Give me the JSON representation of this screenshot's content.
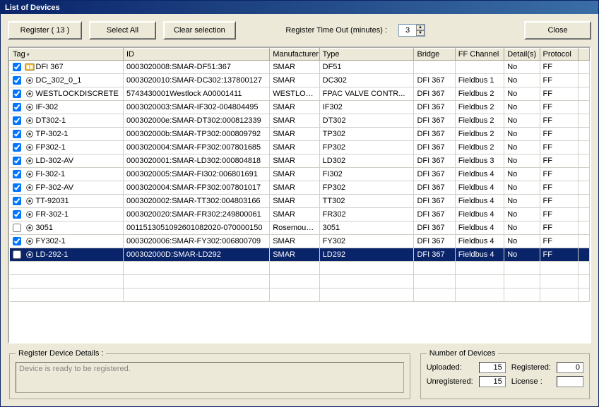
{
  "window": {
    "title": "List of Devices"
  },
  "toolbar": {
    "register_label": "Register ( 13 )",
    "select_all_label": "Select All",
    "clear_selection_label": "Clear selection",
    "timeout_label": "Register Time Out (minutes) :",
    "timeout_value": "3",
    "close_label": "Close"
  },
  "columns": {
    "tag": "Tag",
    "id": "ID",
    "manufacturer": "Manufacturer",
    "type": "Type",
    "bridge": "Bridge",
    "ff_channel": "FF Channel",
    "details": "Detail(s)",
    "protocol": "Protocol"
  },
  "rows": [
    {
      "checked": true,
      "selected": false,
      "icon": "bridge",
      "tag": "DFI 367",
      "id": "0003020008:SMAR-DF51:367",
      "manufacturer": "SMAR",
      "type": "DF51",
      "bridge": "",
      "ff_channel": "",
      "details": "No",
      "protocol": "FF"
    },
    {
      "checked": true,
      "selected": false,
      "icon": "device",
      "tag": "DC_302_0_1",
      "id": "0003020010:SMAR-DC302:137800127",
      "manufacturer": "SMAR",
      "type": "DC302",
      "bridge": "DFI 367",
      "ff_channel": "Fieldbus 1",
      "details": "No",
      "protocol": "FF"
    },
    {
      "checked": true,
      "selected": false,
      "icon": "device",
      "tag": "WESTLOCKDISCRETE",
      "id": "5743430001Westlock    A00001411",
      "manufacturer": "WESTLOCK",
      "type": "FPAC VALVE CONTR...",
      "bridge": "DFI 367",
      "ff_channel": "Fieldbus 2",
      "details": "No",
      "protocol": "FF"
    },
    {
      "checked": true,
      "selected": false,
      "icon": "device",
      "tag": "IF-302",
      "id": "0003020003:SMAR-IF302-004804495",
      "manufacturer": "SMAR",
      "type": "IF302",
      "bridge": "DFI 367",
      "ff_channel": "Fieldbus 2",
      "details": "No",
      "protocol": "FF"
    },
    {
      "checked": true,
      "selected": false,
      "icon": "device",
      "tag": "DT302-1",
      "id": "000302000e:SMAR-DT302:000812339",
      "manufacturer": "SMAR",
      "type": "DT302",
      "bridge": "DFI 367",
      "ff_channel": "Fieldbus 2",
      "details": "No",
      "protocol": "FF"
    },
    {
      "checked": true,
      "selected": false,
      "icon": "device",
      "tag": "TP-302-1",
      "id": "000302000b:SMAR-TP302:000809792",
      "manufacturer": "SMAR",
      "type": "TP302",
      "bridge": "DFI 367",
      "ff_channel": "Fieldbus 2",
      "details": "No",
      "protocol": "FF"
    },
    {
      "checked": true,
      "selected": false,
      "icon": "device",
      "tag": "FP302-1",
      "id": "0003020004:SMAR-FP302:007801685",
      "manufacturer": "SMAR",
      "type": "FP302",
      "bridge": "DFI 367",
      "ff_channel": "Fieldbus 2",
      "details": "No",
      "protocol": "FF"
    },
    {
      "checked": true,
      "selected": false,
      "icon": "device",
      "tag": "LD-302-AV",
      "id": "0003020001:SMAR-LD302:000804818",
      "manufacturer": "SMAR",
      "type": "LD302",
      "bridge": "DFI 367",
      "ff_channel": "Fieldbus 3",
      "details": "No",
      "protocol": "FF"
    },
    {
      "checked": true,
      "selected": false,
      "icon": "device",
      "tag": "FI-302-1",
      "id": "0003020005:SMAR-FI302:006801691",
      "manufacturer": "SMAR",
      "type": "FI302",
      "bridge": "DFI 367",
      "ff_channel": "Fieldbus 4",
      "details": "No",
      "protocol": "FF"
    },
    {
      "checked": true,
      "selected": false,
      "icon": "device",
      "tag": "FP-302-AV",
      "id": "0003020004:SMAR-FP302:007801017",
      "manufacturer": "SMAR",
      "type": "FP302",
      "bridge": "DFI 367",
      "ff_channel": "Fieldbus 4",
      "details": "No",
      "protocol": "FF"
    },
    {
      "checked": true,
      "selected": false,
      "icon": "device",
      "tag": "TT-92031",
      "id": "0003020002:SMAR-TT302:004803166",
      "manufacturer": "SMAR",
      "type": "TT302",
      "bridge": "DFI 367",
      "ff_channel": "Fieldbus 4",
      "details": "No",
      "protocol": "FF"
    },
    {
      "checked": true,
      "selected": false,
      "icon": "device",
      "tag": "FR-302-1",
      "id": "0003020020:SMAR-FR302:249800061",
      "manufacturer": "SMAR",
      "type": "FR302",
      "bridge": "DFI 367",
      "ff_channel": "Fieldbus 4",
      "details": "No",
      "protocol": "FF"
    },
    {
      "checked": false,
      "selected": false,
      "icon": "device",
      "tag": "3051",
      "id": "0011513051092601082020-070000150",
      "manufacturer": "Rosemount...",
      "type": "3051",
      "bridge": "DFI 367",
      "ff_channel": "Fieldbus 4",
      "details": "No",
      "protocol": "FF"
    },
    {
      "checked": true,
      "selected": false,
      "icon": "device",
      "tag": "FY302-1",
      "id": "0003020006:SMAR-FY302:006800709",
      "manufacturer": "SMAR",
      "type": "FY302",
      "bridge": "DFI 367",
      "ff_channel": "Fieldbus 4",
      "details": "No",
      "protocol": "FF"
    },
    {
      "checked": false,
      "selected": true,
      "icon": "device",
      "tag": "LD-292-1",
      "id": "000302000D:SMAR-LD292",
      "manufacturer": "SMAR",
      "type": "LD292",
      "bridge": "DFI 367",
      "ff_channel": "Fieldbus 4",
      "details": "No",
      "protocol": "FF"
    }
  ],
  "details_group": {
    "legend": " Register Device Details : ",
    "text": "Device is ready to be registered."
  },
  "counts_group": {
    "legend": " Number of Devices ",
    "uploaded_label": "Uploaded:",
    "uploaded_value": "15",
    "registered_label": "Registered:",
    "registered_value": "0",
    "unregistered_label": "Unregistered:",
    "unregistered_value": "15",
    "license_label": "License :",
    "license_value": ""
  }
}
